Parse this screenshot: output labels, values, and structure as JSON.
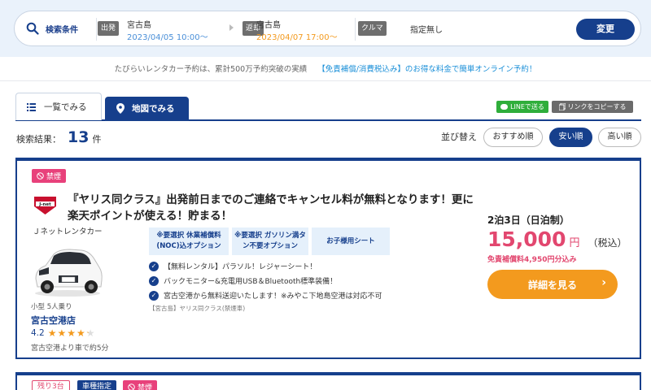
{
  "search": {
    "label": "検索条件",
    "depart_tag": "出発",
    "depart_place": "宮古島",
    "depart_datetime": "2023/04/05 10:00〜",
    "return_tag": "返却",
    "return_place": "宮古島",
    "return_datetime": "2023/04/07 17:00〜",
    "car_tag": "クルマ",
    "car_value": "指定無し",
    "change_label": "変更",
    "colors": {
      "depart_datetime": "#4a8fd8",
      "return_datetime": "#f39a1e"
    }
  },
  "promo": {
    "gray": "たびらいレンタカー予約は、累計500万予約突破の実績",
    "blue": "【免責補償/消費税込み】のお得な料金で簡単オンライン予約！"
  },
  "tabs": {
    "list": "一覧でみる",
    "map": "地図でみる"
  },
  "share": {
    "line": "LINEで送る",
    "copy": "リンクをコピーする"
  },
  "results": {
    "prefix": "検索結果：",
    "count": "13",
    "suffix": "件"
  },
  "sort": {
    "label": "並び替え",
    "options": [
      "おすすめ順",
      "安い順",
      "高い順"
    ],
    "active": "安い順"
  },
  "card": {
    "badge": "禁煙",
    "title": "『ヤリス同クラス』出発前日までのご連絡でキャンセル料が無料となります！更に楽天ポイントが使える！貯まる！",
    "company": "Ｊネットレンタカー",
    "logo_text": "J-net",
    "car_class": "小型 5人乗り",
    "shop": "宮古空港店",
    "rating": "4.2",
    "rating_value": 4.2,
    "access": "宮古空港より車で約5分",
    "options": [
      "※要選択 休業補償料(NOC)込オプション",
      "※要選択 ガソリン満タン不要オプション",
      "お子様用シート"
    ],
    "features": [
      "【無料レンタル】パラソル！レジャーシート！",
      "バックモニター&充電用USB＆Bluetooth標準装備！",
      "宮古空港から無料送迎いたします！※みやこ下地島空港は対応不可"
    ],
    "fine": "【宮古島】ヤリス同クラス(禁煙車)",
    "plan": "2泊3日（日泊制）",
    "price": "15,000",
    "yen": "円",
    "tax": "（税込）",
    "price_note": "免責補償料4,950円分込み",
    "detail_label": "詳細を見る"
  },
  "card2": {
    "badge_left": "残り3台",
    "badge_blue": "車種指定",
    "badge_smoke": "禁煙"
  }
}
